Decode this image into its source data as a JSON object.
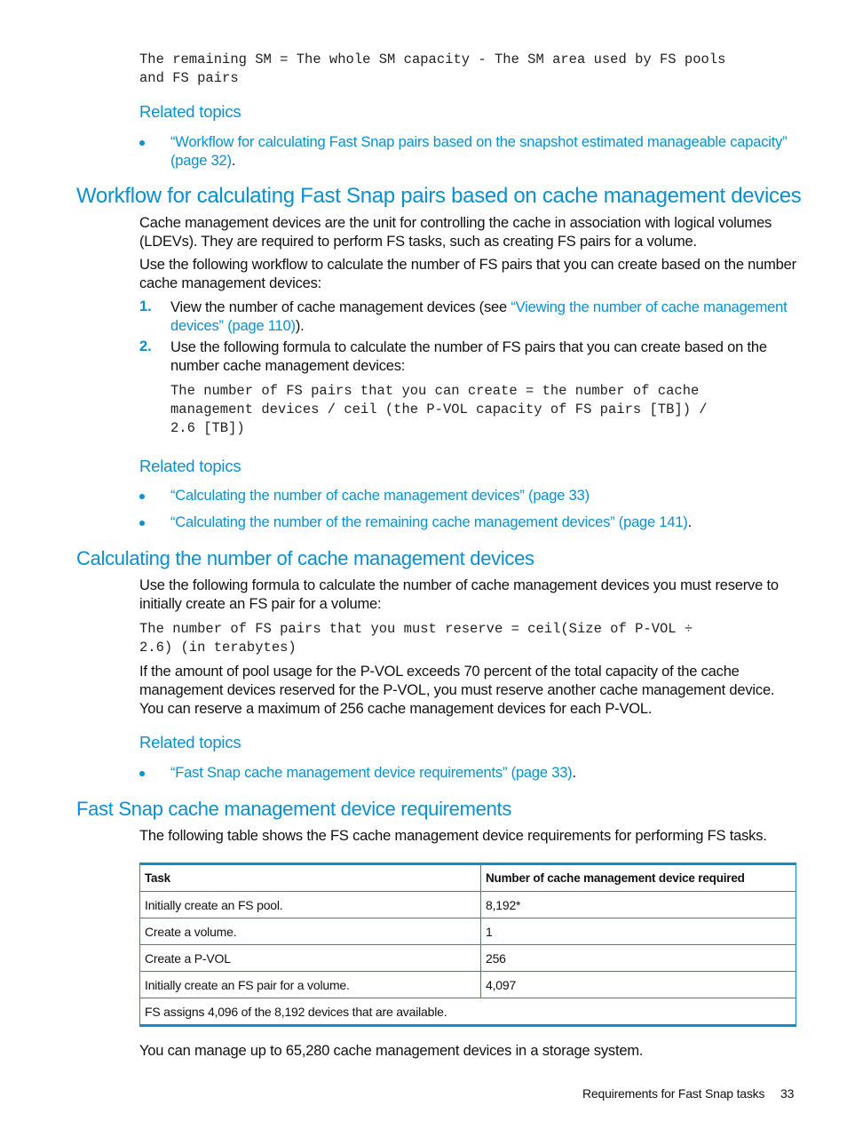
{
  "intro_formula": "The remaining SM = The whole SM capacity - The SM area used by FS pools\nand FS pairs",
  "related_1": {
    "heading": "Related topics",
    "links": [
      {
        "text": "“Workflow for calculating Fast Snap pairs based on the snapshot estimated manageable capacity” (page 32)",
        "suffix": "."
      }
    ]
  },
  "section_workflow": {
    "title": "Workflow for calculating Fast Snap pairs based on cache management devices",
    "para1": "Cache management devices are the unit for controlling the cache in association with logical volumes (LDEVs). They are required to perform FS tasks, such as creating FS pairs for a volume.",
    "para2": "Use the following workflow to calculate the number of FS pairs that you can create based on the number cache management devices:",
    "steps": [
      {
        "number": "1.",
        "text": "View the number of cache management devices (see ",
        "link": "“Viewing the number of cache management devices” (page 110)",
        "suffix": ")."
      },
      {
        "number": "2.",
        "text": "Use the following formula to calculate the number of FS pairs that you can create based on the number cache management devices:"
      }
    ],
    "formula": "The number of FS pairs that you can create = the number of cache\nmanagement devices / ceil (the P-VOL capacity of FS pairs [TB]) /\n2.6 [TB])"
  },
  "related_2": {
    "heading": "Related topics",
    "links": [
      {
        "text": "“Calculating the number of cache management devices” (page 33)",
        "suffix": ""
      },
      {
        "text": "“Calculating the number of the remaining cache management devices” (page 141)",
        "suffix": "."
      }
    ]
  },
  "section_calc": {
    "title": "Calculating the number of cache management devices",
    "para1": "Use the following formula to calculate the number of cache management devices you must reserve to initially create an FS pair for a volume:",
    "formula": "The number of FS pairs that you must reserve = ceil(Size of P-VOL ÷\n2.6) (in terabytes)",
    "para2": "If the amount of pool usage for the P-VOL exceeds 70 percent of the total capacity of the cache management devices reserved for the P-VOL, you must reserve another cache management device. You can reserve a maximum of 256 cache management devices for each P-VOL."
  },
  "related_3": {
    "heading": "Related topics",
    "links": [
      {
        "text": "“Fast Snap cache management device requirements” (page 33)",
        "suffix": "."
      }
    ]
  },
  "section_req": {
    "title": "Fast Snap cache management device requirements",
    "para1": "The following table shows the FS cache management device requirements for performing FS tasks.",
    "table": {
      "headers": [
        "Task",
        "Number of cache management device required"
      ],
      "rows": [
        [
          "Initially create an FS pool.",
          "8,192*"
        ],
        [
          "Create a volume.",
          "1"
        ],
        [
          "Create a P-VOL",
          "256"
        ],
        [
          "Initially create an FS pair for a volume.",
          "4,097"
        ]
      ],
      "footnote": "FS assigns 4,096 of the 8,192 devices that are available."
    },
    "para2": "You can manage up to 65,280 cache management devices in a storage system."
  },
  "footer": {
    "section": "Requirements for Fast Snap tasks",
    "page_number": "33"
  }
}
